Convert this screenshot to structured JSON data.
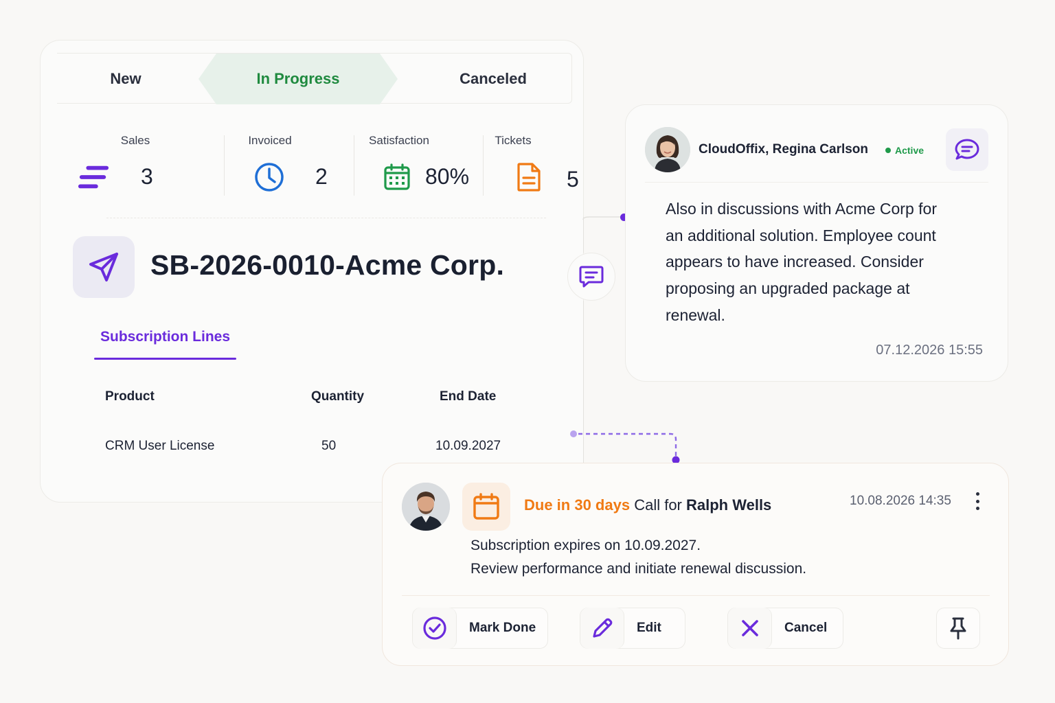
{
  "status_bar": {
    "items": [
      {
        "label": "New",
        "active": false
      },
      {
        "label": "In Progress",
        "active": true
      },
      {
        "label": "Canceled",
        "active": false
      }
    ],
    "active_color": "#1f8a3f"
  },
  "stats": [
    {
      "label": "Sales",
      "value": "3",
      "icon": "sales-bars-icon",
      "color": "#6a2bdc"
    },
    {
      "label": "Invoiced",
      "value": "2",
      "icon": "clock-icon",
      "color": "#1f6fd6"
    },
    {
      "label": "Satisfaction",
      "value": "80%",
      "icon": "calendar-icon",
      "color": "#1f9a4a"
    },
    {
      "label": "Tickets",
      "value": "5",
      "icon": "document-icon",
      "color": "#f07a14"
    }
  ],
  "record": {
    "icon": "send-icon",
    "title": "SB-2026-0010-Acme Corp."
  },
  "tabs": {
    "active_label": "Subscription Lines"
  },
  "table": {
    "headers": [
      "Product",
      "Quantity",
      "End Date"
    ],
    "rows": [
      [
        "CRM User License",
        "50",
        "10.09.2027"
      ]
    ]
  },
  "note": {
    "author": "CloudOffix, Regina Carlson",
    "status": "Active",
    "body": "Also in discussions with Acme Corp for an additional solution. Employee count appears to have increased. Consider proposing an upgraded package at renewal.",
    "timestamp": "07.12.2026 15:55"
  },
  "activity": {
    "due_text": "Due in 30 days",
    "title_mid": " Call for ",
    "contact": "Ralph Wells",
    "timestamp": "10.08.2026 14:35",
    "line1": "Subscription expires on 10.09.2027.",
    "line2": "Review performance and initiate renewal discussion.",
    "buttons": {
      "done": "Mark Done",
      "edit": "Edit",
      "cancel": "Cancel"
    }
  },
  "colors": {
    "accent": "#6a2bdc",
    "due": "#f07a14",
    "active_green": "#1f9a4a"
  }
}
